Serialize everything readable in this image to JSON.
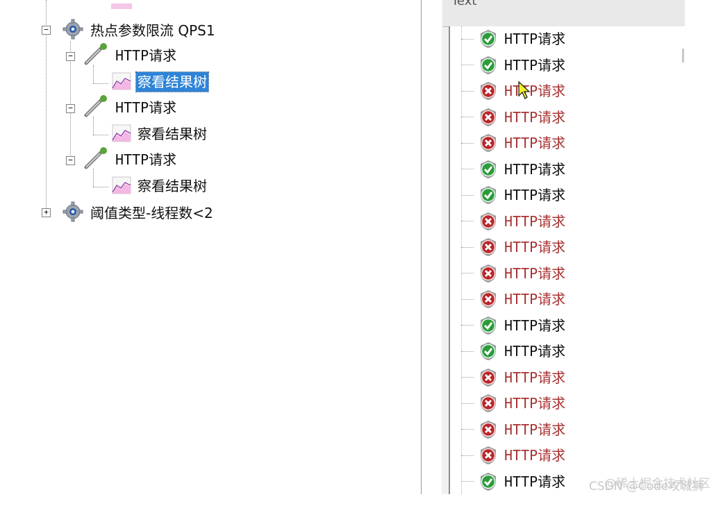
{
  "tree": {
    "nodes": [
      {
        "label": "热点参数限流 QPS1",
        "icon": "gear-icon",
        "expander": "−"
      },
      {
        "label": "HTTP请求",
        "icon": "sampler-pipette-icon",
        "expander": "−"
      },
      {
        "label": "察看结果树",
        "icon": "result-tree-graph-icon",
        "selected": true
      },
      {
        "label": "HTTP请求",
        "icon": "sampler-pipette-icon",
        "expander": "−"
      },
      {
        "label": "察看结果树",
        "icon": "result-tree-graph-icon"
      },
      {
        "label": "HTTP请求",
        "icon": "sampler-pipette-icon",
        "expander": "−"
      },
      {
        "label": "察看结果树",
        "icon": "result-tree-graph-icon"
      },
      {
        "label": "阈值类型-线程数<2",
        "icon": "gear-icon",
        "expander": "+"
      }
    ]
  },
  "results": {
    "header": "Text",
    "items": [
      {
        "label": "HTTP请求",
        "status": "success"
      },
      {
        "label": "HTTP请求",
        "status": "success"
      },
      {
        "label": "HTTP请求",
        "status": "failure"
      },
      {
        "label": "HTTP请求",
        "status": "failure"
      },
      {
        "label": "HTTP请求",
        "status": "failure"
      },
      {
        "label": "HTTP请求",
        "status": "success"
      },
      {
        "label": "HTTP请求",
        "status": "success"
      },
      {
        "label": "HTTP请求",
        "status": "failure"
      },
      {
        "label": "HTTP请求",
        "status": "failure"
      },
      {
        "label": "HTTP请求",
        "status": "failure"
      },
      {
        "label": "HTTP请求",
        "status": "failure"
      },
      {
        "label": "HTTP请求",
        "status": "success"
      },
      {
        "label": "HTTP请求",
        "status": "success"
      },
      {
        "label": "HTTP请求",
        "status": "failure"
      },
      {
        "label": "HTTP请求",
        "status": "failure"
      },
      {
        "label": "HTTP请求",
        "status": "failure"
      },
      {
        "label": "HTTP请求",
        "status": "failure"
      },
      {
        "label": "HTTP请求",
        "status": "success"
      }
    ]
  },
  "colors": {
    "success": "#2e9a3a",
    "failure": "#b8262a",
    "selection": "#2d84d8"
  },
  "watermark": {
    "text1": "@稀土掘金技术社区",
    "text2": "CSDN @Code攻城狮"
  }
}
